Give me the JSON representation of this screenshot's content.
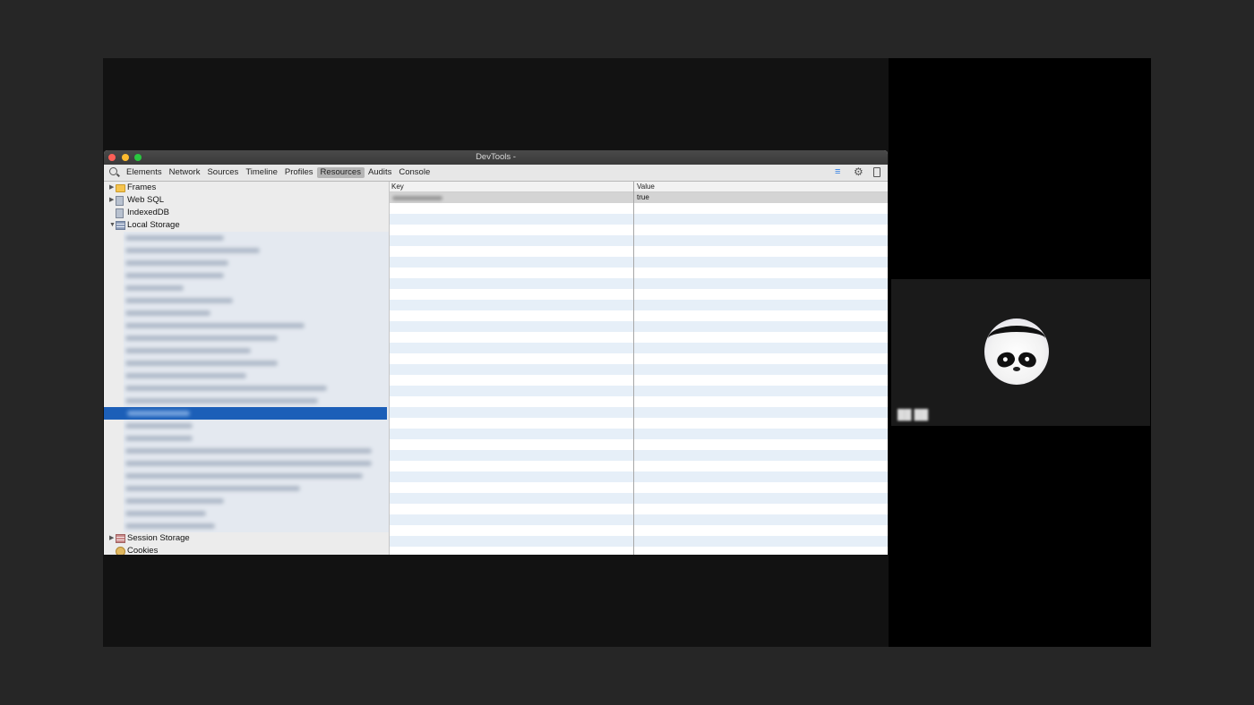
{
  "window": {
    "title": "DevTools -"
  },
  "toolbar": {
    "tabs": [
      {
        "label": "Elements",
        "active": false
      },
      {
        "label": "Network",
        "active": false
      },
      {
        "label": "Sources",
        "active": false
      },
      {
        "label": "Timeline",
        "active": false
      },
      {
        "label": "Profiles",
        "active": false
      },
      {
        "label": "Resources",
        "active": true
      },
      {
        "label": "Audits",
        "active": false
      },
      {
        "label": "Console",
        "active": false
      }
    ],
    "icons": [
      "search-icon",
      "console-drawer-icon",
      "gear-icon",
      "dock-icon"
    ]
  },
  "sidebar": {
    "items": [
      {
        "label": "Frames",
        "icon": "folder-icon",
        "expanded": false
      },
      {
        "label": "Web SQL",
        "icon": "database-icon",
        "expanded": false
      },
      {
        "label": "IndexedDB",
        "icon": "database-icon",
        "expanded": false
      },
      {
        "label": "Local Storage",
        "icon": "storage-grid-icon",
        "expanded": true
      },
      {
        "label": "Session Storage",
        "icon": "storage-grid-icon",
        "expanded": false
      },
      {
        "label": "Cookies",
        "icon": "cookie-icon",
        "expanded": false
      }
    ],
    "local_storage_child_count": 24,
    "selected_child_index": 14
  },
  "grid": {
    "columns": [
      "Key",
      "Value"
    ],
    "rows": [
      {
        "key_visible": false,
        "value": "true"
      }
    ]
  },
  "meeting": {
    "participant_avatar": "panda-avatar-icon"
  },
  "colors": {
    "accent_selection": "#1c5fb8",
    "active_tab": "#b5b5b5",
    "stripe": "#e6eff8"
  }
}
